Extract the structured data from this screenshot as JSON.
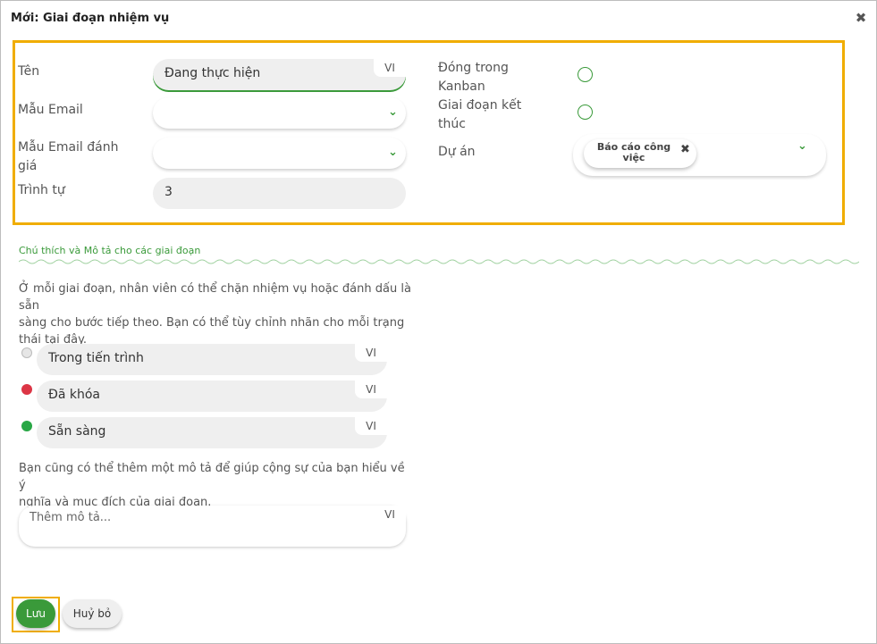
{
  "dialog": {
    "title": "Mới: Giai đoạn nhiệm vụ",
    "close_icon": "close-icon"
  },
  "form": {
    "name_label": "Tên",
    "name_value": "Đang thực hiện",
    "lang_tag": "VI",
    "email_template_label": "Mẫu Email",
    "email_template_value": "",
    "rating_email_template_label_line1": "Mẫu Email đánh",
    "rating_email_template_label_line2": "giá",
    "rating_email_template_value": "",
    "sequence_label": "Trình tự",
    "sequence_value": "3",
    "folded_label_line1": "Đóng trong",
    "folded_label_line2": "Kanban",
    "folded_checked": false,
    "closing_stage_label_line1": "Giai đoạn kết",
    "closing_stage_label_line2": "thúc",
    "closing_stage_checked": false,
    "project_label": "Dự án",
    "project_tag_line1": "Báo cáo công",
    "project_tag_line2": "việc"
  },
  "legend": {
    "section_title": "Chú thích và Mô tả cho các giai đoạn",
    "intro_line1": "Ở mỗi giai đoạn, nhân viên có thể chặn nhiệm vụ hoặc đánh dấu là sẵn",
    "intro_line2": "sàng cho bước tiếp theo. Bạn có thể tùy chỉnh nhãn cho mỗi trạng",
    "intro_line3": "thái tại đây.",
    "states": [
      {
        "label": "Trong tiến trình",
        "color": "#e6e6e6",
        "lang": "VI"
      },
      {
        "label": "Đã khóa",
        "color": "#dc3545",
        "lang": "VI"
      },
      {
        "label": "Sẵn sàng",
        "color": "#28a745",
        "lang": "VI"
      }
    ],
    "desc_intro_line1": "Bạn cũng có thể thêm một mô tả để giúp cộng sự của bạn hiểu về ý",
    "desc_intro_line2": "nghĩa và mục đích của giai đoạn.",
    "desc_placeholder": "Thêm mô tả...",
    "desc_lang": "VI"
  },
  "footer": {
    "save_label": "Lưu",
    "cancel_label": "Huỷ bỏ"
  },
  "colors": {
    "accent": "#3a9a3a",
    "highlight": "#f0ad00"
  }
}
